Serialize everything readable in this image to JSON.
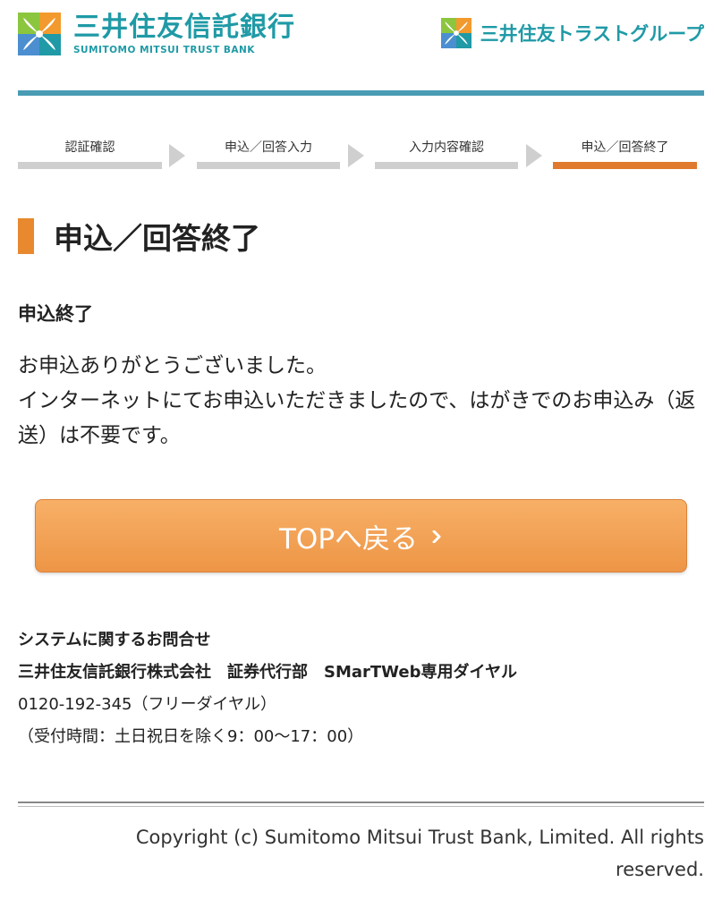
{
  "header": {
    "bank_name_jp": "三井住友信託銀行",
    "bank_name_en": "SUMITOMO MITSUI TRUST BANK",
    "group_name": "三井住友トラストグループ"
  },
  "steps": [
    {
      "label": "認証確認",
      "active": false
    },
    {
      "label": "申込／回答入力",
      "active": false
    },
    {
      "label": "入力内容確認",
      "active": false
    },
    {
      "label": "申込／回答終了",
      "active": true
    }
  ],
  "page": {
    "title": "申込／回答終了",
    "section_heading": "申込終了",
    "message_line1": "お申込ありがとうございました。",
    "message_line2": "インターネットにてお申込いただきましたので、はがきでのお申込み（返送）は不要です。"
  },
  "top_button": {
    "label": "TOPへ戻る"
  },
  "contact": {
    "heading": "システムに関するお問合せ",
    "company": "三井住友信託銀行株式会社　証券代行部　SMarTWeb専用ダイヤル",
    "phone": "0120-192-345（フリーダイヤル）",
    "hours": "（受付時間：土日祝日を除く9：00〜17：00）"
  },
  "footer": {
    "copyright": "Copyright (c) Sumitomo Mitsui Trust Bank, Limited. All rights reserved."
  },
  "colors": {
    "brand_teal": "#1f9aa6",
    "header_line": "#4a9cb5",
    "accent_orange": "#e07a2e",
    "button_orange": "#ee9546"
  }
}
